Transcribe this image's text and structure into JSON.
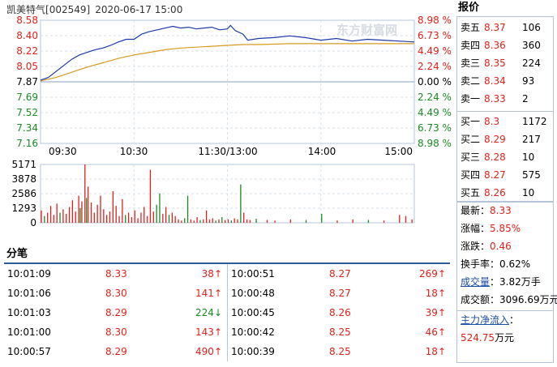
{
  "header": {
    "stock_name": "凯美特气",
    "stock_code": "[002549]",
    "datetime": "2020-06-17 15:00",
    "watermark": "东方财富网"
  },
  "price_axis": {
    "left_labels": [
      "8.58",
      "8.40",
      "8.22",
      "8.05",
      "7.87",
      "7.69",
      "7.52",
      "7.34",
      "7.16"
    ],
    "right_labels": [
      "8.98 %",
      "6.73 %",
      "4.49 %",
      "2.24 %",
      "0.00 %",
      "2.24 %",
      "4.49 %",
      "6.73 %",
      "8.98 %"
    ]
  },
  "time_labels": [
    "09:30",
    "10:30",
    "11:30/13:00",
    "14:00",
    "15:00"
  ],
  "volume_axis": {
    "labels": [
      "5171",
      "3878",
      "2586",
      "1293",
      "0"
    ]
  },
  "colors": {
    "up": "#e0211b",
    "down": "#1b8a23",
    "price_line": "#1b3aa8",
    "avg_line": "#d69b22",
    "border": "#b6c4d8"
  },
  "quote": {
    "title": "报价",
    "asks": [
      {
        "label": "卖五",
        "price": "8.37",
        "vol": "106"
      },
      {
        "label": "卖四",
        "price": "8.36",
        "vol": "360"
      },
      {
        "label": "卖三",
        "price": "8.35",
        "vol": "224"
      },
      {
        "label": "卖二",
        "price": "8.34",
        "vol": "93"
      },
      {
        "label": "卖一",
        "price": "8.33",
        "vol": "2"
      }
    ],
    "bids": [
      {
        "label": "买一",
        "price": "8.3",
        "vol": "1172"
      },
      {
        "label": "买二",
        "price": "8.29",
        "vol": "217"
      },
      {
        "label": "买三",
        "price": "8.28",
        "vol": "10"
      },
      {
        "label": "买四",
        "price": "8.27",
        "vol": "575"
      },
      {
        "label": "买五",
        "price": "8.26",
        "vol": "10"
      }
    ],
    "info": {
      "latest_label": "最新：",
      "latest": "8.33",
      "change_pct_label": "涨幅：",
      "change_pct": "5.85%",
      "change_label": "涨跌：",
      "change": "0.46",
      "turnover_label": "换手率：",
      "turnover": "0.62%",
      "volume_label": "成交量",
      "volume_sep": "：",
      "volume": "3.82万手",
      "amount_label": "成交额：",
      "amount": "3096.69万元",
      "inflow_label": "主力净流入",
      "inflow_sep": "：",
      "inflow_value": "524.75",
      "inflow_unit": "万元"
    }
  },
  "ticks": {
    "title": "分笔",
    "left": [
      {
        "time": "10:01:09",
        "price": "8.33",
        "vol": "38",
        "dir": "up"
      },
      {
        "time": "10:01:06",
        "price": "8.30",
        "vol": "141",
        "dir": "up"
      },
      {
        "time": "10:01:03",
        "price": "8.29",
        "vol": "224",
        "dir": "down"
      },
      {
        "time": "10:01:00",
        "price": "8.30",
        "vol": "143",
        "dir": "up"
      },
      {
        "time": "10:00:57",
        "price": "8.29",
        "vol": "490",
        "dir": "up"
      }
    ],
    "right": [
      {
        "time": "10:00:51",
        "price": "8.27",
        "vol": "269",
        "dir": "up"
      },
      {
        "time": "10:00:48",
        "price": "8.27",
        "vol": "18",
        "dir": "up"
      },
      {
        "time": "10:00:45",
        "price": "8.26",
        "vol": "39",
        "dir": "up"
      },
      {
        "time": "10:00:42",
        "price": "8.25",
        "vol": "46",
        "dir": "up"
      },
      {
        "time": "10:00:39",
        "price": "8.25",
        "vol": "18",
        "dir": "up"
      }
    ]
  },
  "chart_data": {
    "type": "line",
    "x_unit": "trading minutes since 09:30 (0-240)",
    "prev_close": 7.87,
    "ylim": [
      7.16,
      8.58
    ],
    "series": [
      {
        "name": "price",
        "points": [
          [
            0,
            7.89
          ],
          [
            5,
            7.92
          ],
          [
            10,
            7.99
          ],
          [
            15,
            8.06
          ],
          [
            20,
            8.13
          ],
          [
            25,
            8.18
          ],
          [
            30,
            8.21
          ],
          [
            35,
            8.24
          ],
          [
            40,
            8.26
          ],
          [
            45,
            8.29
          ],
          [
            50,
            8.33
          ],
          [
            55,
            8.36
          ],
          [
            60,
            8.36
          ],
          [
            65,
            8.42
          ],
          [
            70,
            8.45
          ],
          [
            75,
            8.47
          ],
          [
            80,
            8.49
          ],
          [
            85,
            8.51
          ],
          [
            90,
            8.49
          ],
          [
            95,
            8.5
          ],
          [
            100,
            8.48
          ],
          [
            105,
            8.49
          ],
          [
            110,
            8.5
          ],
          [
            115,
            8.47
          ],
          [
            120,
            8.48
          ],
          [
            122,
            8.52
          ],
          [
            125,
            8.46
          ],
          [
            130,
            8.42
          ],
          [
            133,
            8.35
          ],
          [
            140,
            8.37
          ],
          [
            150,
            8.38
          ],
          [
            160,
            8.4
          ],
          [
            170,
            8.38
          ],
          [
            180,
            8.35
          ],
          [
            190,
            8.37
          ],
          [
            200,
            8.34
          ],
          [
            210,
            8.36
          ],
          [
            220,
            8.35
          ],
          [
            230,
            8.34
          ],
          [
            240,
            8.33
          ]
        ]
      },
      {
        "name": "average",
        "points": [
          [
            0,
            7.88
          ],
          [
            10,
            7.92
          ],
          [
            20,
            7.98
          ],
          [
            30,
            8.04
          ],
          [
            40,
            8.09
          ],
          [
            50,
            8.14
          ],
          [
            60,
            8.18
          ],
          [
            70,
            8.21
          ],
          [
            80,
            8.24
          ],
          [
            90,
            8.26
          ],
          [
            100,
            8.27
          ],
          [
            110,
            8.28
          ],
          [
            120,
            8.29
          ],
          [
            130,
            8.3
          ],
          [
            140,
            8.3
          ],
          [
            160,
            8.31
          ],
          [
            180,
            8.31
          ],
          [
            200,
            8.31
          ],
          [
            220,
            8.31
          ],
          [
            240,
            8.31
          ]
        ]
      }
    ],
    "volume": {
      "ylim": [
        0,
        5171
      ],
      "bars": [
        [
          0,
          1100,
          "up"
        ],
        [
          2,
          600,
          "down"
        ],
        [
          4,
          900,
          "up"
        ],
        [
          6,
          1500,
          "up"
        ],
        [
          8,
          700,
          "up"
        ],
        [
          10,
          1700,
          "up"
        ],
        [
          12,
          900,
          "down"
        ],
        [
          14,
          1200,
          "up"
        ],
        [
          16,
          800,
          "up"
        ],
        [
          18,
          1400,
          "up"
        ],
        [
          20,
          2000,
          "up"
        ],
        [
          22,
          1000,
          "up"
        ],
        [
          24,
          2400,
          "up"
        ],
        [
          25,
          1300,
          "down"
        ],
        [
          26,
          1900,
          "up"
        ],
        [
          28,
          5171,
          "up"
        ],
        [
          29,
          2200,
          "down"
        ],
        [
          30,
          3200,
          "up"
        ],
        [
          32,
          1800,
          "up"
        ],
        [
          34,
          900,
          "up"
        ],
        [
          36,
          1600,
          "up"
        ],
        [
          38,
          2400,
          "up"
        ],
        [
          40,
          1200,
          "up"
        ],
        [
          42,
          700,
          "up"
        ],
        [
          44,
          1000,
          "up"
        ],
        [
          46,
          2800,
          "up"
        ],
        [
          48,
          1500,
          "up"
        ],
        [
          50,
          600,
          "up"
        ],
        [
          52,
          2100,
          "up"
        ],
        [
          54,
          700,
          "down"
        ],
        [
          56,
          900,
          "up"
        ],
        [
          58,
          500,
          "up"
        ],
        [
          60,
          1100,
          "up"
        ],
        [
          62,
          400,
          "up"
        ],
        [
          64,
          900,
          "up"
        ],
        [
          66,
          1400,
          "up"
        ],
        [
          68,
          600,
          "up"
        ],
        [
          70,
          4700,
          "up"
        ],
        [
          72,
          1000,
          "up"
        ],
        [
          74,
          1600,
          "down"
        ],
        [
          76,
          2600,
          "down"
        ],
        [
          78,
          800,
          "up"
        ],
        [
          80,
          1400,
          "up"
        ],
        [
          82,
          700,
          "down"
        ],
        [
          84,
          900,
          "up"
        ],
        [
          86,
          600,
          "up"
        ],
        [
          88,
          300,
          "up"
        ],
        [
          90,
          200,
          "up"
        ],
        [
          92,
          400,
          "down"
        ],
        [
          94,
          2400,
          "down"
        ],
        [
          96,
          300,
          "up"
        ],
        [
          98,
          200,
          "up"
        ],
        [
          100,
          500,
          "up"
        ],
        [
          102,
          250,
          "down"
        ],
        [
          104,
          300,
          "up"
        ],
        [
          106,
          1100,
          "up"
        ],
        [
          108,
          300,
          "up"
        ],
        [
          110,
          400,
          "up"
        ],
        [
          112,
          200,
          "down"
        ],
        [
          114,
          300,
          "up"
        ],
        [
          116,
          500,
          "down"
        ],
        [
          118,
          250,
          "up"
        ],
        [
          120,
          300,
          "up"
        ],
        [
          122,
          200,
          "down"
        ],
        [
          124,
          400,
          "up"
        ],
        [
          126,
          300,
          "up"
        ],
        [
          128,
          3400,
          "down"
        ],
        [
          130,
          900,
          "up"
        ],
        [
          132,
          300,
          "up"
        ],
        [
          134,
          250,
          "up"
        ],
        [
          138,
          350,
          "down"
        ],
        [
          145,
          250,
          "up"
        ],
        [
          150,
          200,
          "up"
        ],
        [
          160,
          300,
          "up"
        ],
        [
          170,
          250,
          "down"
        ],
        [
          180,
          800,
          "down"
        ],
        [
          190,
          200,
          "up"
        ],
        [
          200,
          300,
          "up"
        ],
        [
          210,
          250,
          "down"
        ],
        [
          220,
          200,
          "up"
        ],
        [
          230,
          700,
          "up"
        ],
        [
          234,
          600,
          "up"
        ],
        [
          238,
          300,
          "up"
        ]
      ]
    }
  }
}
